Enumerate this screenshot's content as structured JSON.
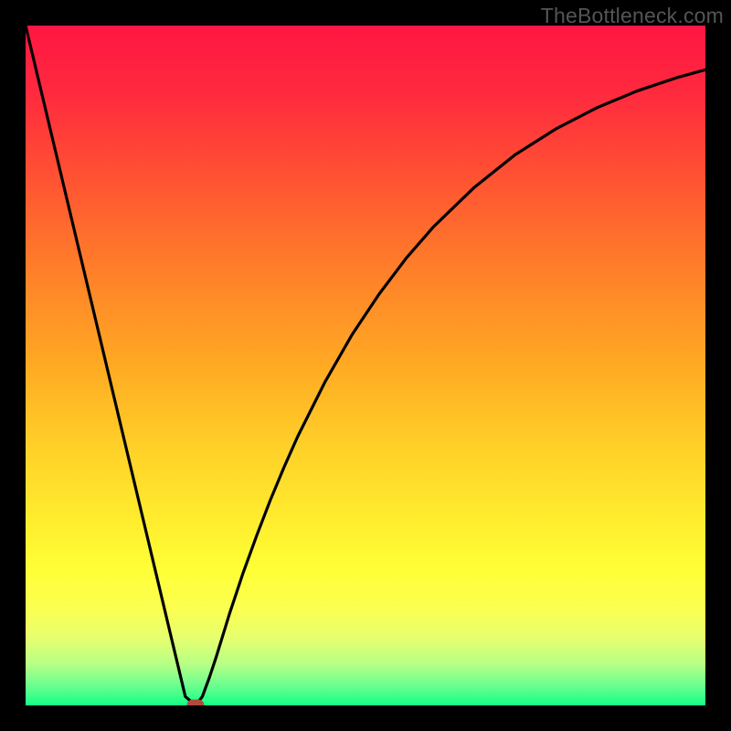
{
  "watermark": "TheBottleneck.com",
  "chart_data": {
    "type": "line",
    "title": "",
    "xlabel": "",
    "ylabel": "",
    "xlim": [
      0,
      100
    ],
    "ylim": [
      0,
      100
    ],
    "grid": false,
    "series": [
      {
        "name": "curve",
        "x": [
          0,
          2,
          4,
          6,
          8,
          10,
          12,
          14,
          16,
          18,
          20,
          22,
          23.5,
          25,
          26,
          27,
          28,
          30,
          32,
          34,
          36,
          38,
          40,
          44,
          48,
          52,
          56,
          60,
          66,
          72,
          78,
          84,
          90,
          96,
          100
        ],
        "values": [
          100,
          91.6,
          83.2,
          74.8,
          66.4,
          58.0,
          49.6,
          41.2,
          32.8,
          24.4,
          16.0,
          7.6,
          1.3,
          0.0,
          1.3,
          4.0,
          7.0,
          13.5,
          19.5,
          25.0,
          30.2,
          35.0,
          39.5,
          47.5,
          54.5,
          60.5,
          65.8,
          70.4,
          76.2,
          81.0,
          84.8,
          87.9,
          90.4,
          92.4,
          93.5
        ]
      }
    ],
    "marker": {
      "x": 25,
      "y": 0,
      "color": "#b24a3c"
    },
    "gradient_stops": [
      {
        "offset": 0.0,
        "color": "#ff1643"
      },
      {
        "offset": 0.1,
        "color": "#ff2a3e"
      },
      {
        "offset": 0.22,
        "color": "#ff5133"
      },
      {
        "offset": 0.36,
        "color": "#ff7f29"
      },
      {
        "offset": 0.5,
        "color": "#ffaa23"
      },
      {
        "offset": 0.62,
        "color": "#ffd028"
      },
      {
        "offset": 0.74,
        "color": "#fff02f"
      },
      {
        "offset": 0.8,
        "color": "#ffff36"
      },
      {
        "offset": 0.86,
        "color": "#faff52"
      },
      {
        "offset": 0.9,
        "color": "#e7ff6e"
      },
      {
        "offset": 0.94,
        "color": "#b6ff85"
      },
      {
        "offset": 0.97,
        "color": "#6cff8e"
      },
      {
        "offset": 1.0,
        "color": "#14ff86"
      }
    ]
  }
}
